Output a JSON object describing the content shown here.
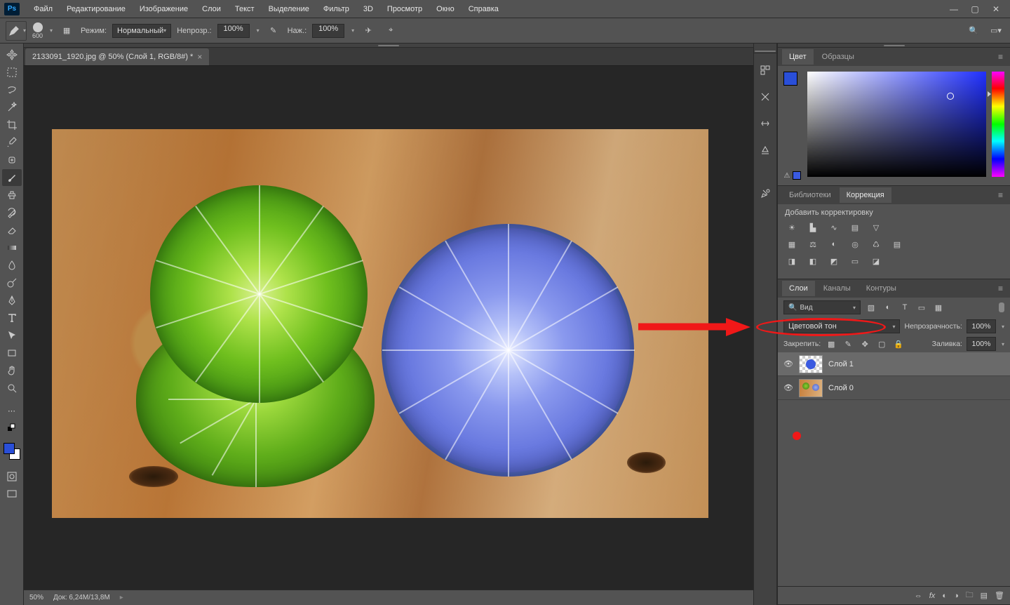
{
  "menubar": {
    "items": [
      "Файл",
      "Редактирование",
      "Изображение",
      "Слои",
      "Текст",
      "Выделение",
      "Фильтр",
      "3D",
      "Просмотр",
      "Окно",
      "Справка"
    ]
  },
  "options": {
    "brush_size": "600",
    "mode_label": "Режим:",
    "mode_value": "Нормальный",
    "opacity_label": "Непрозр.:",
    "opacity_value": "100%",
    "flow_label": "Наж.:",
    "flow_value": "100%"
  },
  "document": {
    "tab_title": "2133091_1920.jpg @ 50% (Слой 1, RGB/8#) *"
  },
  "status": {
    "zoom": "50%",
    "doc_label": "Док:",
    "doc_size": "6,24M/13,8M"
  },
  "panels": {
    "color_tab": "Цвет",
    "swatches_tab": "Образцы",
    "libraries_tab": "Библиотеки",
    "adjustments_tab": "Коррекция",
    "adjustments_hint": "Добавить корректировку",
    "layers_tab": "Слои",
    "channels_tab": "Каналы",
    "paths_tab": "Контуры"
  },
  "layers": {
    "kind_label": "Вид",
    "blend_mode": "Цветовой тон",
    "opacity_label": "Непрозрачность:",
    "opacity_value": "100%",
    "lock_label": "Закрепить:",
    "fill_label": "Заливка:",
    "fill_value": "100%",
    "items": [
      {
        "name": "Слой 1"
      },
      {
        "name": "Слой 0"
      }
    ]
  }
}
